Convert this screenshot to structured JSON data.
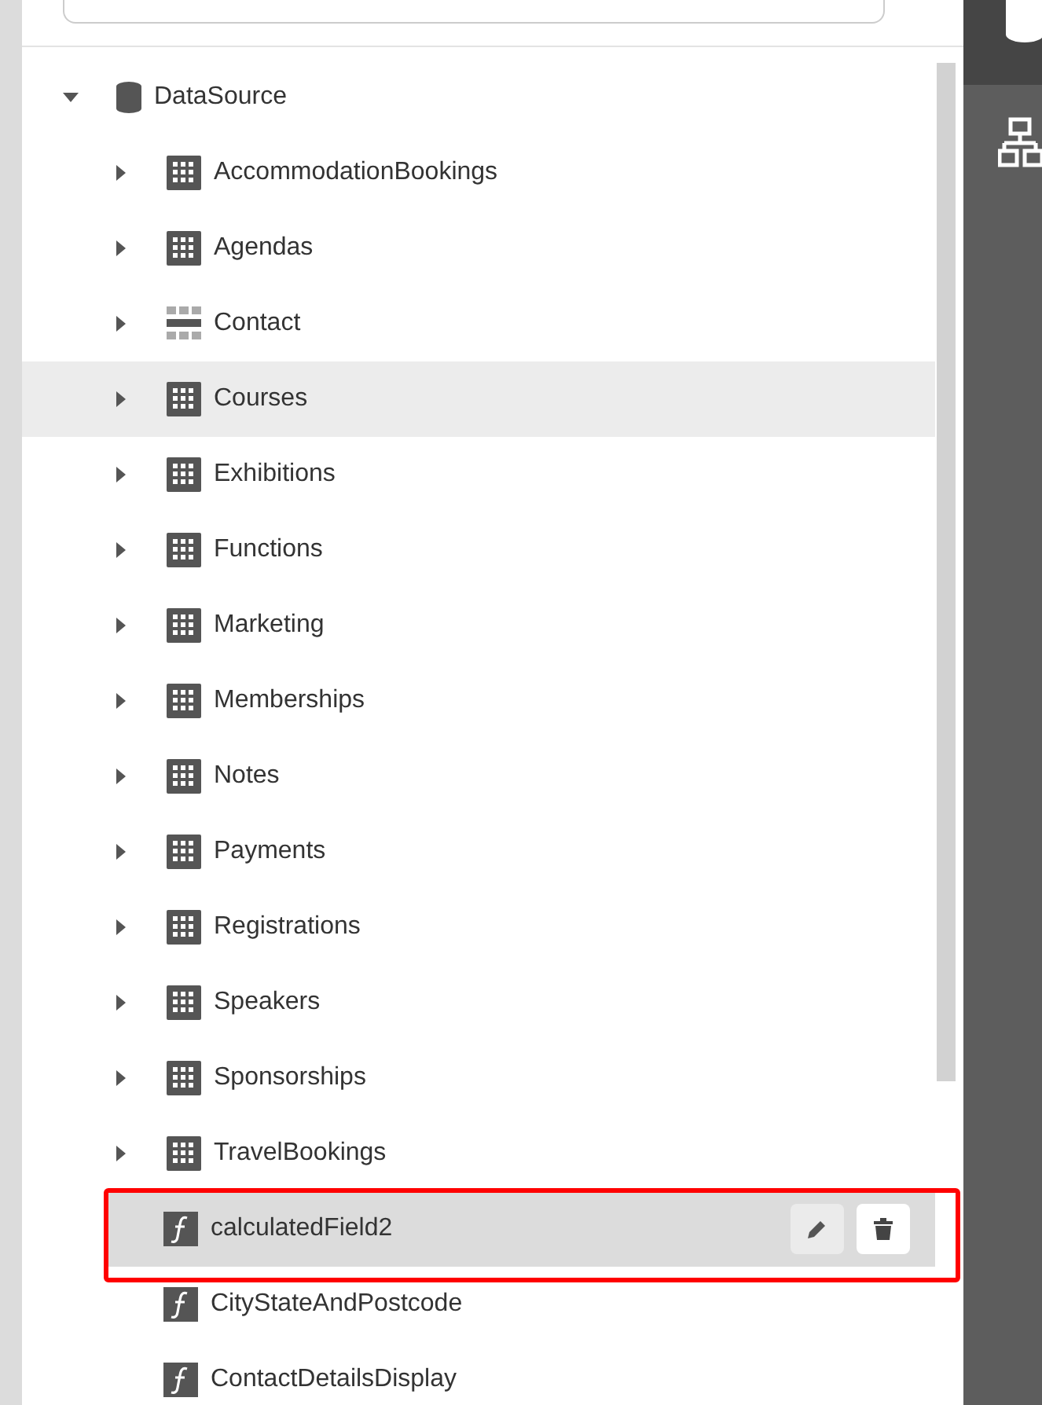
{
  "tree": [
    {
      "label": "DataSource",
      "kind": "source",
      "expanded": true,
      "selected": false,
      "hovered": false,
      "children": [
        {
          "label": "AccommodationBookings",
          "kind": "table",
          "expanded": false,
          "selected": false,
          "hovered": false
        },
        {
          "label": "Agendas",
          "kind": "table",
          "expanded": false,
          "selected": false,
          "hovered": false
        },
        {
          "label": "Contact",
          "kind": "view",
          "expanded": false,
          "selected": false,
          "hovered": false
        },
        {
          "label": "Courses",
          "kind": "table",
          "expanded": false,
          "selected": false,
          "hovered": true
        },
        {
          "label": "Exhibitions",
          "kind": "table",
          "expanded": false,
          "selected": false,
          "hovered": false
        },
        {
          "label": "Functions",
          "kind": "table",
          "expanded": false,
          "selected": false,
          "hovered": false
        },
        {
          "label": "Marketing",
          "kind": "table",
          "expanded": false,
          "selected": false,
          "hovered": false
        },
        {
          "label": "Memberships",
          "kind": "table",
          "expanded": false,
          "selected": false,
          "hovered": false
        },
        {
          "label": "Notes",
          "kind": "table",
          "expanded": false,
          "selected": false,
          "hovered": false
        },
        {
          "label": "Payments",
          "kind": "table",
          "expanded": false,
          "selected": false,
          "hovered": false
        },
        {
          "label": "Registrations",
          "kind": "table",
          "expanded": false,
          "selected": false,
          "hovered": false
        },
        {
          "label": "Speakers",
          "kind": "table",
          "expanded": false,
          "selected": false,
          "hovered": false
        },
        {
          "label": "Sponsorships",
          "kind": "table",
          "expanded": false,
          "selected": false,
          "hovered": false
        },
        {
          "label": "TravelBookings",
          "kind": "table",
          "expanded": false,
          "selected": false,
          "hovered": false
        },
        {
          "label": "calculatedField2",
          "kind": "field",
          "selected": true,
          "hovered": false,
          "annotated": true
        },
        {
          "label": "CityStateAndPostcode",
          "kind": "field",
          "selected": false,
          "hovered": false,
          "annotated": false
        },
        {
          "label": "ContactDetailsDisplay",
          "kind": "field",
          "selected": false,
          "hovered": false,
          "annotated": false
        }
      ]
    }
  ]
}
